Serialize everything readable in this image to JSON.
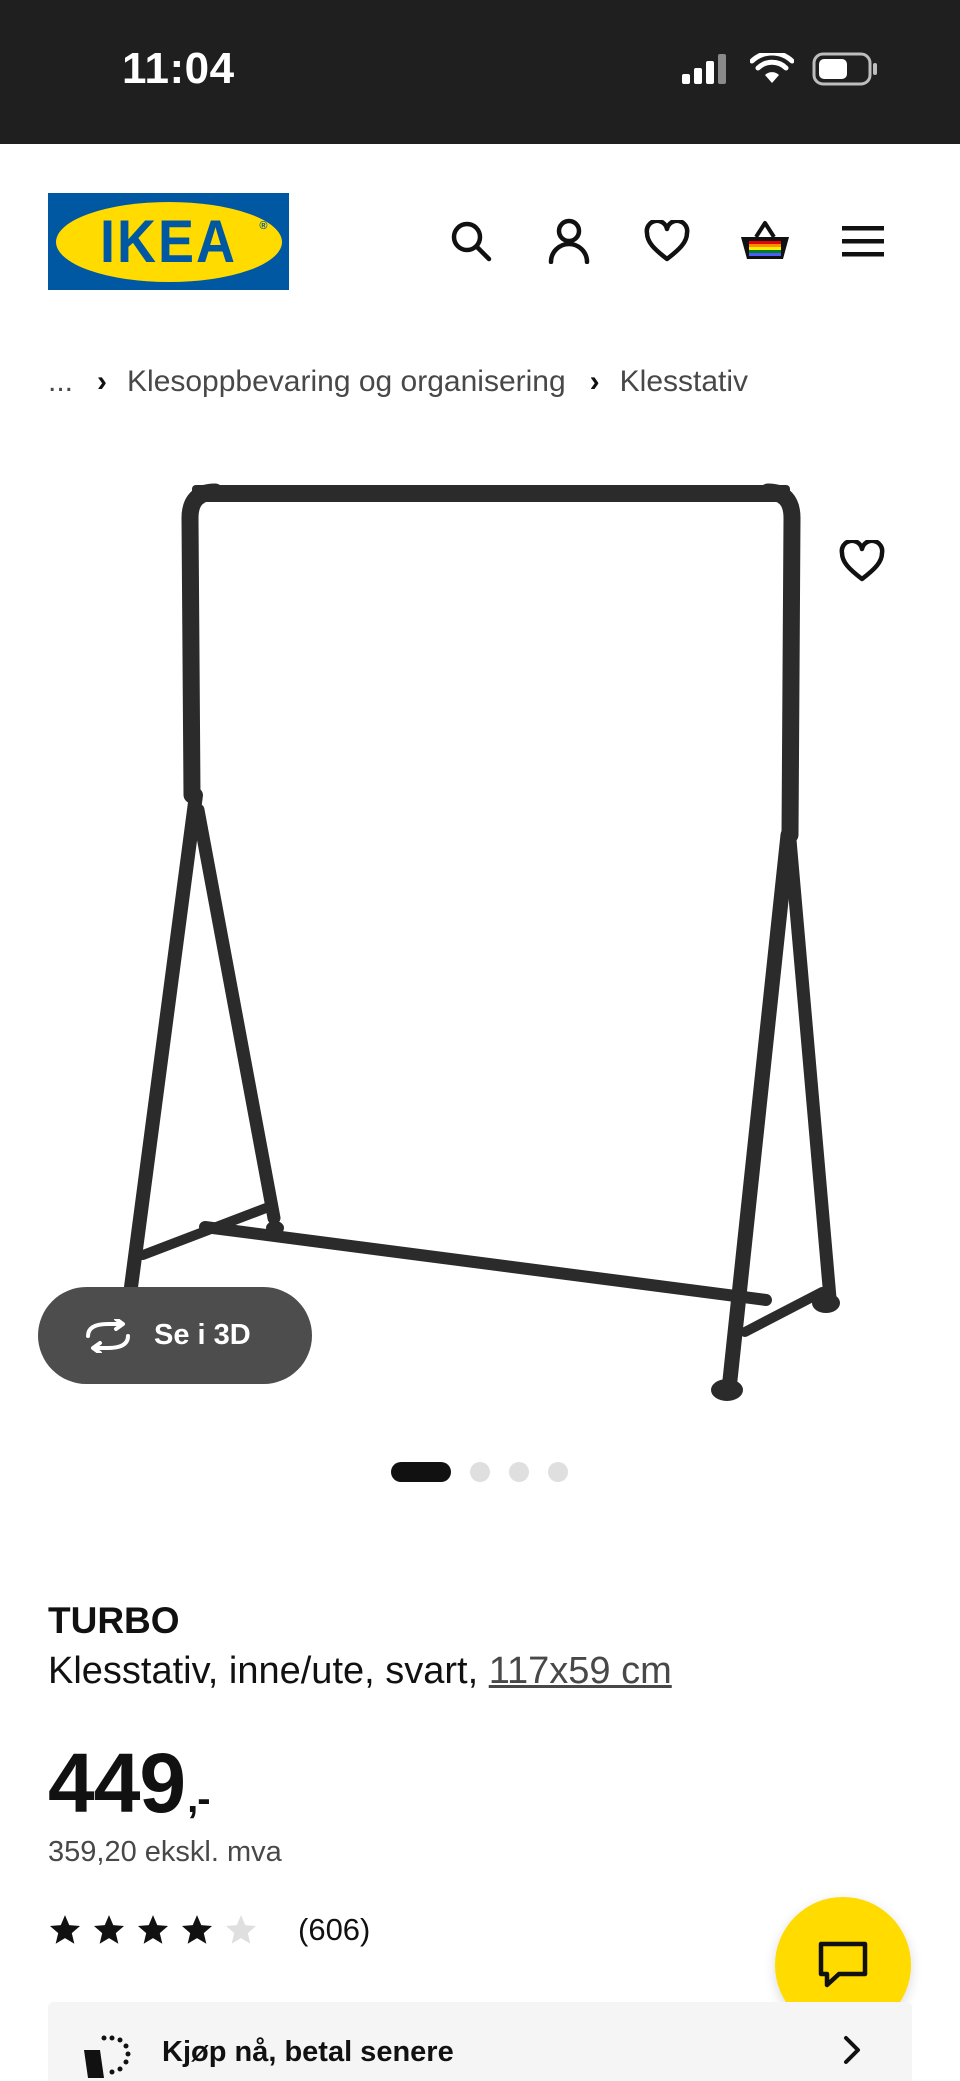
{
  "status_bar": {
    "time": "11:04",
    "icons": [
      "signal-icon",
      "wifi-icon",
      "battery-icon"
    ]
  },
  "header": {
    "logo_text": "IKEA",
    "icons": [
      "search-icon",
      "account-icon",
      "heart-icon",
      "cart-icon",
      "menu-icon"
    ]
  },
  "breadcrumb": {
    "items": [
      "...",
      "Klesoppbevaring og organisering",
      "Klesstativ"
    ]
  },
  "gallery": {
    "view_3d_label": "Se i 3D",
    "dot_count": 4,
    "active_index": 0
  },
  "product": {
    "name": "TURBO",
    "description": "Klesstativ, inne/ute, svart, ",
    "size": "117x59 cm",
    "price": "449",
    "price_suffix": ",-",
    "price_ex_vat": "359,20 ekskl. mva",
    "rating": 4,
    "rating_max": 5,
    "review_count": "(606)"
  },
  "payment": {
    "label": "Kjøp nå, betal senere"
  },
  "colors": {
    "ikea_blue": "#0058a3",
    "ikea_yellow": "#ffdb00",
    "status_bar": "#1f1f1f"
  }
}
